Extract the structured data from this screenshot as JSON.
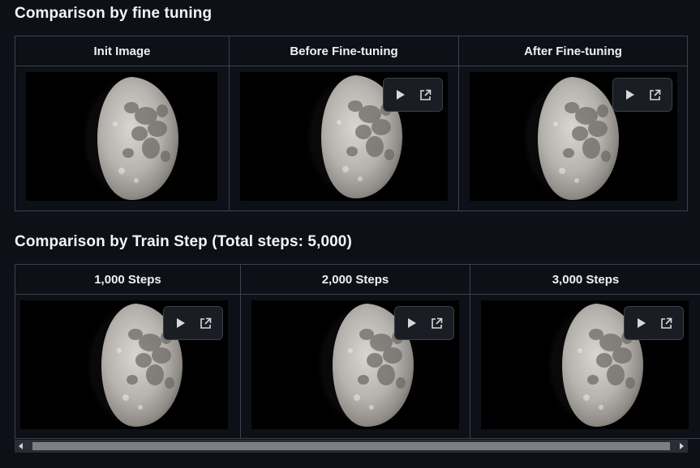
{
  "section1": {
    "title": "Comparison by fine tuning",
    "columns": [
      {
        "label": "Init Image",
        "has_controls": false
      },
      {
        "label": "Before Fine-tuning",
        "has_controls": true
      },
      {
        "label": "After Fine-tuning",
        "has_controls": true
      }
    ]
  },
  "section2": {
    "title": "Comparison by Train Step (Total steps: 5,000)",
    "columns": [
      {
        "label": "1,000 Steps",
        "has_controls": true
      },
      {
        "label": "2,000 Steps",
        "has_controls": true
      },
      {
        "label": "3,000 Steps",
        "has_controls": true
      }
    ]
  },
  "icons": {
    "play": "play-icon",
    "open_external": "external-link-icon",
    "scroll_left": "scroll-left-arrow-icon",
    "scroll_right": "scroll-right-arrow-icon"
  },
  "colors": {
    "background": "#0d1017",
    "border": "#3b414c",
    "control_bg": "#1a1d24",
    "scroll_thumb": "#7d7f84"
  }
}
